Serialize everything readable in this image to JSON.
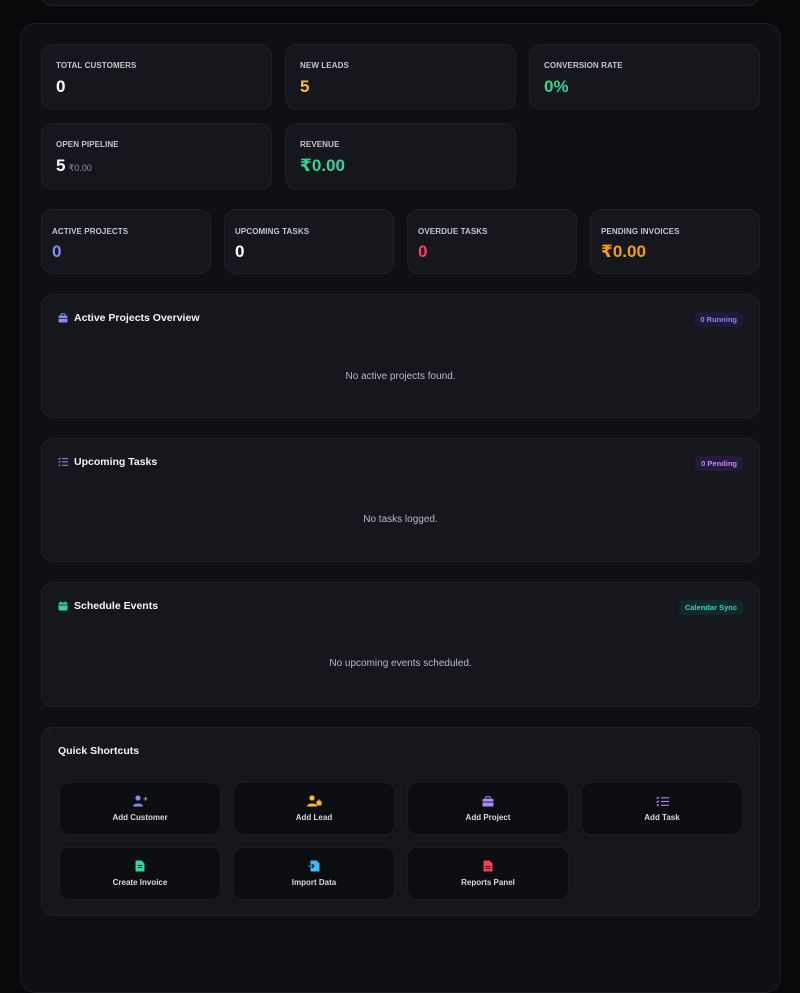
{
  "stats_row1": [
    {
      "label": "TOTAL CUSTOMERS",
      "value": "0"
    },
    {
      "label": "NEW LEADS",
      "value": "5"
    },
    {
      "label": "CONVERSION RATE",
      "value": "0%"
    }
  ],
  "stats_row2": [
    {
      "label": "OPEN PIPELINE",
      "value": "5",
      "sub": "₹0.00"
    },
    {
      "label": "REVENUE",
      "value": "₹0.00"
    }
  ],
  "stats_row3": [
    {
      "label": "ACTIVE PROJECTS",
      "value": "0"
    },
    {
      "label": "UPCOMING TASKS",
      "value": "0"
    },
    {
      "label": "OVERDUE TASKS",
      "value": "0"
    },
    {
      "label": "PENDING INVOICES",
      "value": "₹0.00"
    }
  ],
  "projects": {
    "title": "Active Projects Overview",
    "badge": "0 Running",
    "empty": "No active projects found."
  },
  "tasks": {
    "title": "Upcoming Tasks",
    "badge": "0 Pending",
    "empty": "No tasks logged."
  },
  "events": {
    "title": "Schedule Events",
    "badge": "Calendar Sync",
    "empty": "No upcoming events scheduled."
  },
  "shortcuts": {
    "title": "Quick Shortcuts",
    "items": [
      {
        "label": "Add Customer",
        "icon": "user-plus-icon"
      },
      {
        "label": "Add Lead",
        "icon": "user-tie-icon"
      },
      {
        "label": "Add Project",
        "icon": "briefcase-icon"
      },
      {
        "label": "Add Task",
        "icon": "checklist-icon"
      },
      {
        "label": "Create Invoice",
        "icon": "invoice-icon"
      },
      {
        "label": "Import Data",
        "icon": "file-import-icon"
      },
      {
        "label": "Reports Panel",
        "icon": "file-pdf-icon"
      }
    ]
  },
  "colors": {
    "yellow": "#fbbf24",
    "green": "#34d399",
    "indigo": "#818cf8",
    "rose": "#f43f5e",
    "amber": "#f59e0b",
    "purple": "#c084fc",
    "teal": "#2dd4bf"
  }
}
